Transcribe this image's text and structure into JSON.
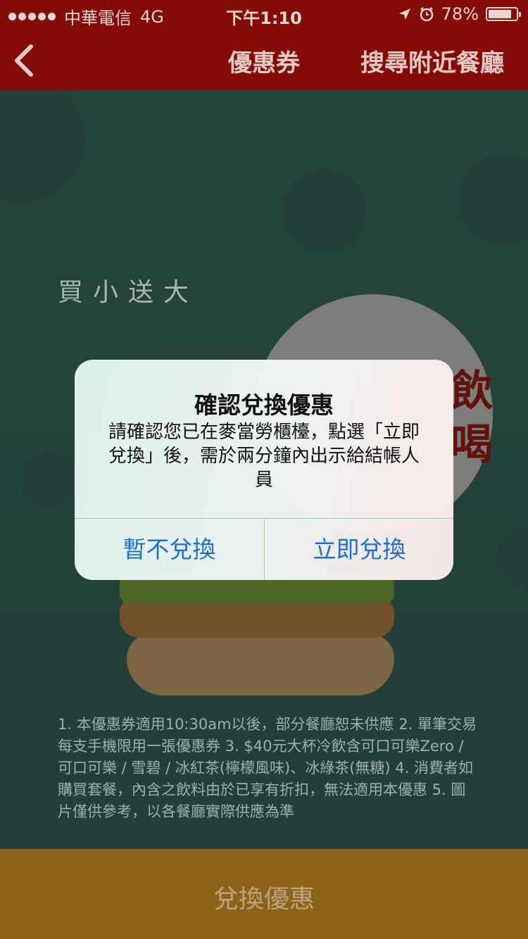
{
  "status_bar": {
    "carrier": "中華電信",
    "network": "4G",
    "time": "下午1:10",
    "battery": "78%",
    "battery_level": 0.78,
    "icons": [
      "signal-dots",
      "location-arrow-icon",
      "alarm-icon",
      "battery-icon"
    ]
  },
  "nav": {
    "title": "優惠券",
    "right_action": "搜尋附近餐廳",
    "back_icon": "chevron-left-icon"
  },
  "coupon": {
    "headline": "買小送大",
    "promo_partial": "飲\n喝",
    "terms": "1. 本優惠券適用10:30am以後，部分餐廳恕未供應 2. 單筆交易每支手機限用一張優惠券 3. $40元大杯冷飲含可口可樂Zero / 可口可樂 / 雪碧 / 冰紅茶(檸檬風味)、冰綠茶(無糖) 4. 消費者如購買套餐，內含之飲料由於已享有折扣，無法適用本優惠 5. 圖片僅供參考，以各餐廳實際供應為準"
  },
  "bottom_button": {
    "label": "兌換優惠"
  },
  "alert": {
    "title": "確認兌換優惠",
    "message": "請確認您已在麥當勞櫃檯，點選「立即兌換」後，需於兩分鐘內出示給結帳人員",
    "cancel_label": "暫不兌換",
    "confirm_label": "立即兌換"
  },
  "colors": {
    "nav_red": "#850c06",
    "bottom_gold": "#8e6319",
    "alert_button_blue": "#1b6fd6"
  }
}
